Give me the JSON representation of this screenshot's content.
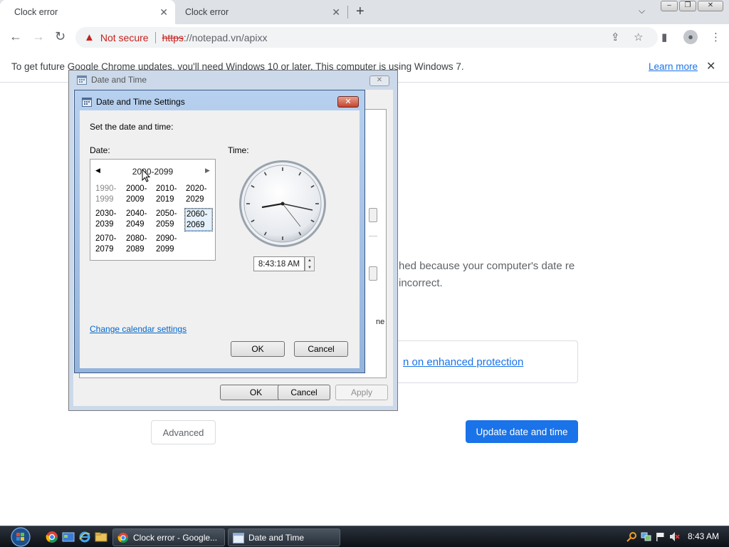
{
  "browser": {
    "tabs": [
      {
        "title": "Clock error",
        "active": true
      },
      {
        "title": "Clock error",
        "active": false
      }
    ],
    "omnibox": {
      "security_label": "Not secure",
      "url_scheme": "https",
      "url_rest": "://notepad.vn/apixx"
    },
    "infobar": {
      "message": "To get future Google Chrome updates, you'll need Windows 10 or later. This computer is using Windows 7.",
      "learn_more": "Learn more"
    }
  },
  "page": {
    "error_text": "hed because your computer's date re incorrect.",
    "enhanced_protection_link": "n on enhanced protection",
    "advanced_button": "Advanced",
    "update_button": "Update date and time"
  },
  "date_time_dialog": {
    "title": "Date and Time",
    "truncated_label": "ne",
    "ok": "OK",
    "cancel": "Cancel",
    "apply": "Apply"
  },
  "settings_dialog": {
    "title": "Date and Time Settings",
    "instruction": "Set the date and time:",
    "date_label": "Date:",
    "time_label": "Time:",
    "calendar": {
      "header": "2000-2099",
      "decades": [
        {
          "line1": "1990-",
          "line2": "1999",
          "dim": true,
          "selected": false
        },
        {
          "line1": "2000-",
          "line2": "2009",
          "dim": false,
          "selected": false
        },
        {
          "line1": "2010-",
          "line2": "2019",
          "dim": false,
          "selected": false
        },
        {
          "line1": "2020-",
          "line2": "2029",
          "dim": false,
          "selected": false
        },
        {
          "line1": "2030-",
          "line2": "2039",
          "dim": false,
          "selected": false
        },
        {
          "line1": "2040-",
          "line2": "2049",
          "dim": false,
          "selected": false
        },
        {
          "line1": "2050-",
          "line2": "2059",
          "dim": false,
          "selected": false
        },
        {
          "line1": "2060-",
          "line2": "2069",
          "dim": false,
          "selected": true
        },
        {
          "line1": "2070-",
          "line2": "2079",
          "dim": false,
          "selected": false
        },
        {
          "line1": "2080-",
          "line2": "2089",
          "dim": false,
          "selected": false
        },
        {
          "line1": "2090-",
          "line2": "2099",
          "dim": false,
          "selected": false
        }
      ]
    },
    "time_value": "8:43:18 AM",
    "change_calendar_link": "Change calendar settings",
    "ok": "OK",
    "cancel": "Cancel"
  },
  "taskbar": {
    "tasks": [
      {
        "label": "Clock error - Google...",
        "icon": "chrome-icon"
      },
      {
        "label": "Date and Time",
        "icon": "date-time-icon"
      }
    ],
    "clock": "8:43 AM"
  },
  "colors": {
    "chrome_accent": "#1a73e8",
    "insecure_red": "#c5221f",
    "win7_title": "#b7d0ef"
  }
}
